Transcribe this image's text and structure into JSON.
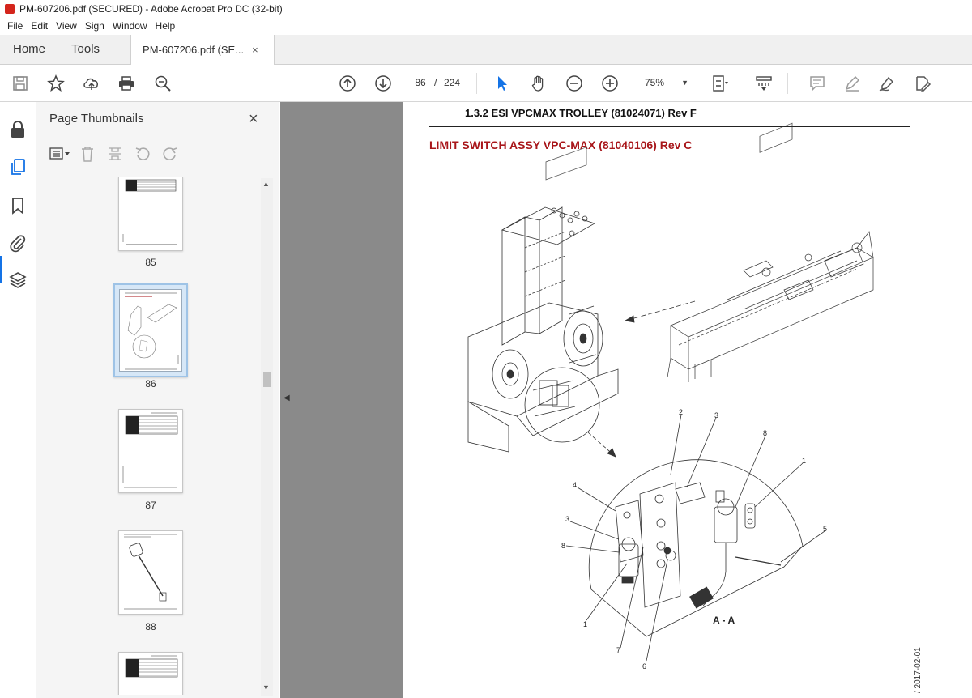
{
  "window": {
    "title": "PM-607206.pdf (SECURED) - Adobe Acrobat Pro DC (32-bit)"
  },
  "menu": [
    "File",
    "Edit",
    "View",
    "Sign",
    "Window",
    "Help"
  ],
  "tabs": {
    "home": "Home",
    "tools": "Tools",
    "document": "PM-607206.pdf (SE...",
    "close": "×"
  },
  "toolbar": {
    "current_page": "86",
    "page_separator": "/",
    "total_pages": "224",
    "zoom": "75%"
  },
  "thumbnails": {
    "title": "Page Thumbnails",
    "close": "×",
    "pages": [
      "85",
      "86",
      "87",
      "88"
    ],
    "selected_page": "86"
  },
  "document": {
    "header": "1.3.2 ESI VPCMAX TROLLEY (81024071) Rev F",
    "section_title": "LIMIT SWITCH ASSY VPC-MAX (81040106) Rev C",
    "view_label": "A - A",
    "callouts": [
      "2",
      "3",
      "8",
      "1",
      "4",
      "3",
      "8",
      "5",
      "1",
      "7",
      "6"
    ],
    "side_date": "/ 2017-02-01"
  },
  "colors": {
    "accent": "#1473e6",
    "section_title": "#a8161a",
    "canvas": "#8a8a8a"
  }
}
